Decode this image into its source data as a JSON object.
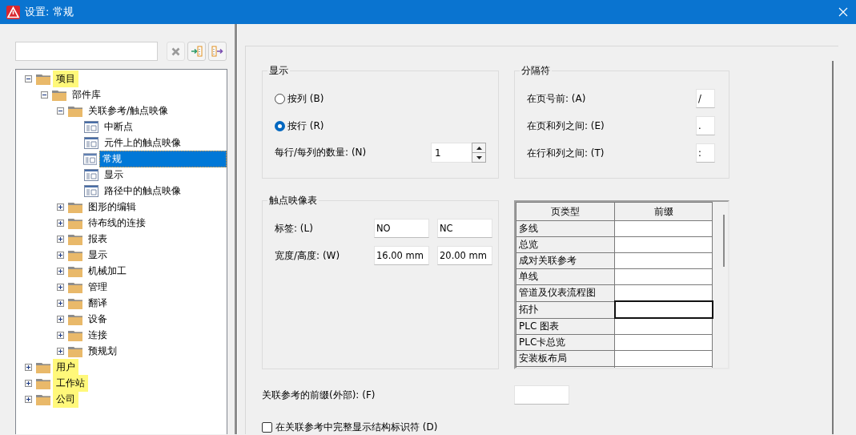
{
  "window": {
    "title": "设置: 常规"
  },
  "tree": [
    {
      "label": "项目",
      "kind": "folder",
      "expanded": true,
      "selected": false,
      "highlighted": true,
      "children": [
        {
          "label": "部件库",
          "kind": "folder",
          "expanded": true,
          "selected": false,
          "highlighted": false,
          "children": [
            {
              "label": "关联参考/触点映像",
              "kind": "folder",
              "expanded": true,
              "selected": false,
              "highlighted": false,
              "children": [
                {
                  "label": "中断点",
                  "kind": "page",
                  "selected": false,
                  "highlighted": false
                },
                {
                  "label": "元件上的触点映像",
                  "kind": "page",
                  "selected": false,
                  "highlighted": false
                },
                {
                  "label": "常规",
                  "kind": "page",
                  "selected": true,
                  "highlighted": false
                },
                {
                  "label": "显示",
                  "kind": "page",
                  "selected": false,
                  "highlighted": false
                },
                {
                  "label": "路径中的触点映像",
                  "kind": "page",
                  "selected": false,
                  "highlighted": false
                }
              ]
            },
            {
              "label": "图形的编辑",
              "kind": "folder",
              "expanded": false,
              "selected": false,
              "highlighted": false
            },
            {
              "label": "待布线的连接",
              "kind": "folder",
              "expanded": false,
              "selected": false,
              "highlighted": false
            },
            {
              "label": "报表",
              "kind": "folder",
              "expanded": false,
              "selected": false,
              "highlighted": false
            },
            {
              "label": "显示",
              "kind": "folder",
              "expanded": false,
              "selected": false,
              "highlighted": false
            },
            {
              "label": "机械加工",
              "kind": "folder",
              "expanded": false,
              "selected": false,
              "highlighted": false
            },
            {
              "label": "管理",
              "kind": "folder",
              "expanded": false,
              "selected": false,
              "highlighted": false
            },
            {
              "label": "翻译",
              "kind": "folder",
              "expanded": false,
              "selected": false,
              "highlighted": false
            },
            {
              "label": "设备",
              "kind": "folder",
              "expanded": false,
              "selected": false,
              "highlighted": false
            },
            {
              "label": "连接",
              "kind": "folder",
              "expanded": false,
              "selected": false,
              "highlighted": false
            },
            {
              "label": "预规划",
              "kind": "folder",
              "expanded": false,
              "selected": false,
              "highlighted": false
            }
          ]
        }
      ]
    },
    {
      "label": "用户",
      "kind": "folder",
      "expanded": false,
      "selected": false,
      "highlighted": true
    },
    {
      "label": "工作站",
      "kind": "folder",
      "expanded": false,
      "selected": false,
      "highlighted": true
    },
    {
      "label": "公司",
      "kind": "folder",
      "expanded": false,
      "selected": false,
      "highlighted": true
    }
  ],
  "display_group": {
    "title": "显示",
    "options": [
      {
        "label": "按列 (B)",
        "selected": false
      },
      {
        "label": "按行 (R)",
        "selected": true
      }
    ],
    "count": {
      "label": "每行/每列的数量: (N)",
      "value": "1"
    }
  },
  "separator_group": {
    "title": "分隔符",
    "fields": [
      {
        "label": "在页号前: (A)",
        "value": "/"
      },
      {
        "label": "在页和列之间: (E)",
        "value": "."
      },
      {
        "label": "在行和列之间: (T)",
        "value": ":"
      }
    ]
  },
  "contact_group": {
    "title": "触点映像表",
    "rows": [
      {
        "label": "标签: (L)",
        "values": [
          "NO",
          "NC"
        ]
      },
      {
        "label": "宽度/高度: (W)",
        "values": [
          "16.00 mm",
          "20.00 mm"
        ]
      }
    ]
  },
  "prefix_table": {
    "columns": [
      "页类型",
      "前缀"
    ],
    "rows": [
      {
        "page_type": "多线",
        "focused": false
      },
      {
        "page_type": "总览",
        "focused": false
      },
      {
        "page_type": "成对关联参考",
        "focused": false
      },
      {
        "page_type": "单线",
        "focused": false
      },
      {
        "page_type": "管道及仪表流程图",
        "focused": false
      },
      {
        "page_type": "拓扑",
        "focused": true
      },
      {
        "page_type": "PLC 图表",
        "focused": false
      },
      {
        "page_type": "PLC卡总览",
        "focused": false
      },
      {
        "page_type": "安装板布局",
        "focused": false
      }
    ]
  },
  "external_prefix": {
    "label": "关联参考的前缀(外部): (F)"
  },
  "show_full_identifier": {
    "label": "在关联参考中完整显示结构标识符 (D)",
    "checked": false
  }
}
